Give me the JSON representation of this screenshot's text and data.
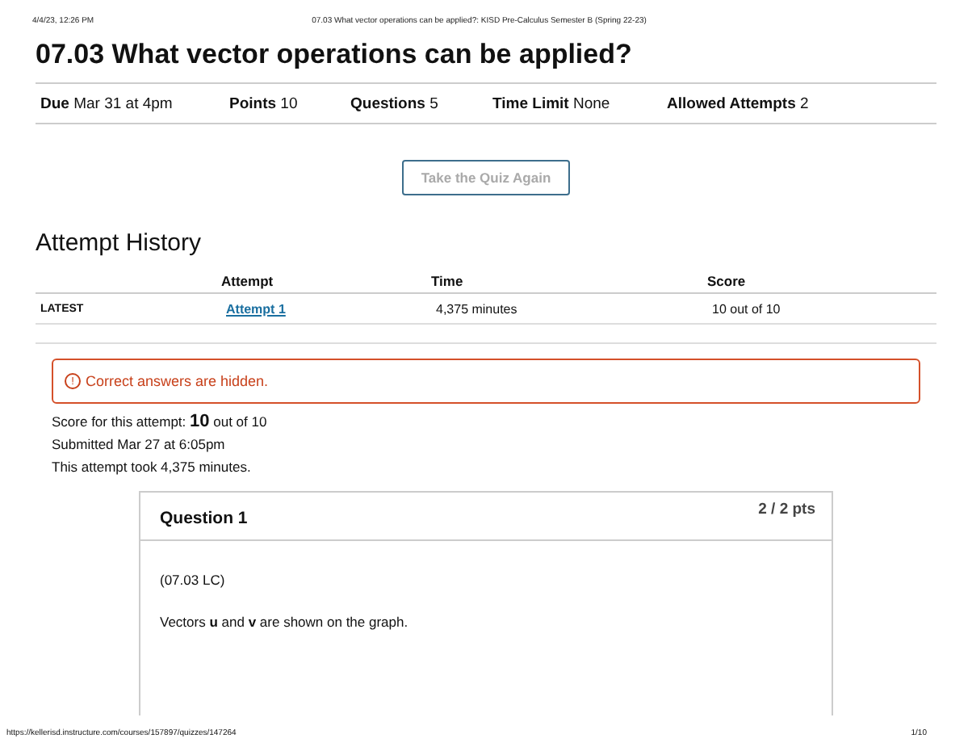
{
  "print_header": {
    "date": "4/4/23, 12:26 PM",
    "title": "07.03 What vector operations can be applied?: KISD Pre-Calculus Semester B (Spring 22-23)"
  },
  "title": "07.03 What vector operations can be applied?",
  "details": [
    {
      "label": "Due",
      "value": "Mar 31 at 4pm"
    },
    {
      "label": "Points",
      "value": "10"
    },
    {
      "label": "Questions",
      "value": "5"
    },
    {
      "label": "Time Limit",
      "value": "None"
    },
    {
      "label": "Allowed Attempts",
      "value": "2"
    }
  ],
  "retake_button": {
    "label": "Take the Quiz Again",
    "disabled": true
  },
  "attempt_history": {
    "heading": "Attempt History",
    "columns": [
      "Attempt",
      "Time",
      "Score"
    ],
    "rows": [
      {
        "tag": "LATEST",
        "attempt": "Attempt 1",
        "time": "4,375 minutes",
        "score": "10 out of 10"
      }
    ]
  },
  "alert": {
    "icon": "!",
    "text": "Correct answers are hidden."
  },
  "summary": [
    "Score for this attempt: **10** out of 10",
    "Submitted Mar 27 at 6:05pm",
    "This attempt took 4,375 minutes."
  ],
  "question": {
    "title": "Question 1",
    "points": "2 / 2 pts",
    "paragraphs": [
      "(07.03 LC)",
      "Vectors **u** and **v** are shown on the graph."
    ]
  },
  "print_footer": {
    "url": "https://kellerisd.instructure.com/courses/157897/quizzes/147264",
    "page": "1/10"
  }
}
